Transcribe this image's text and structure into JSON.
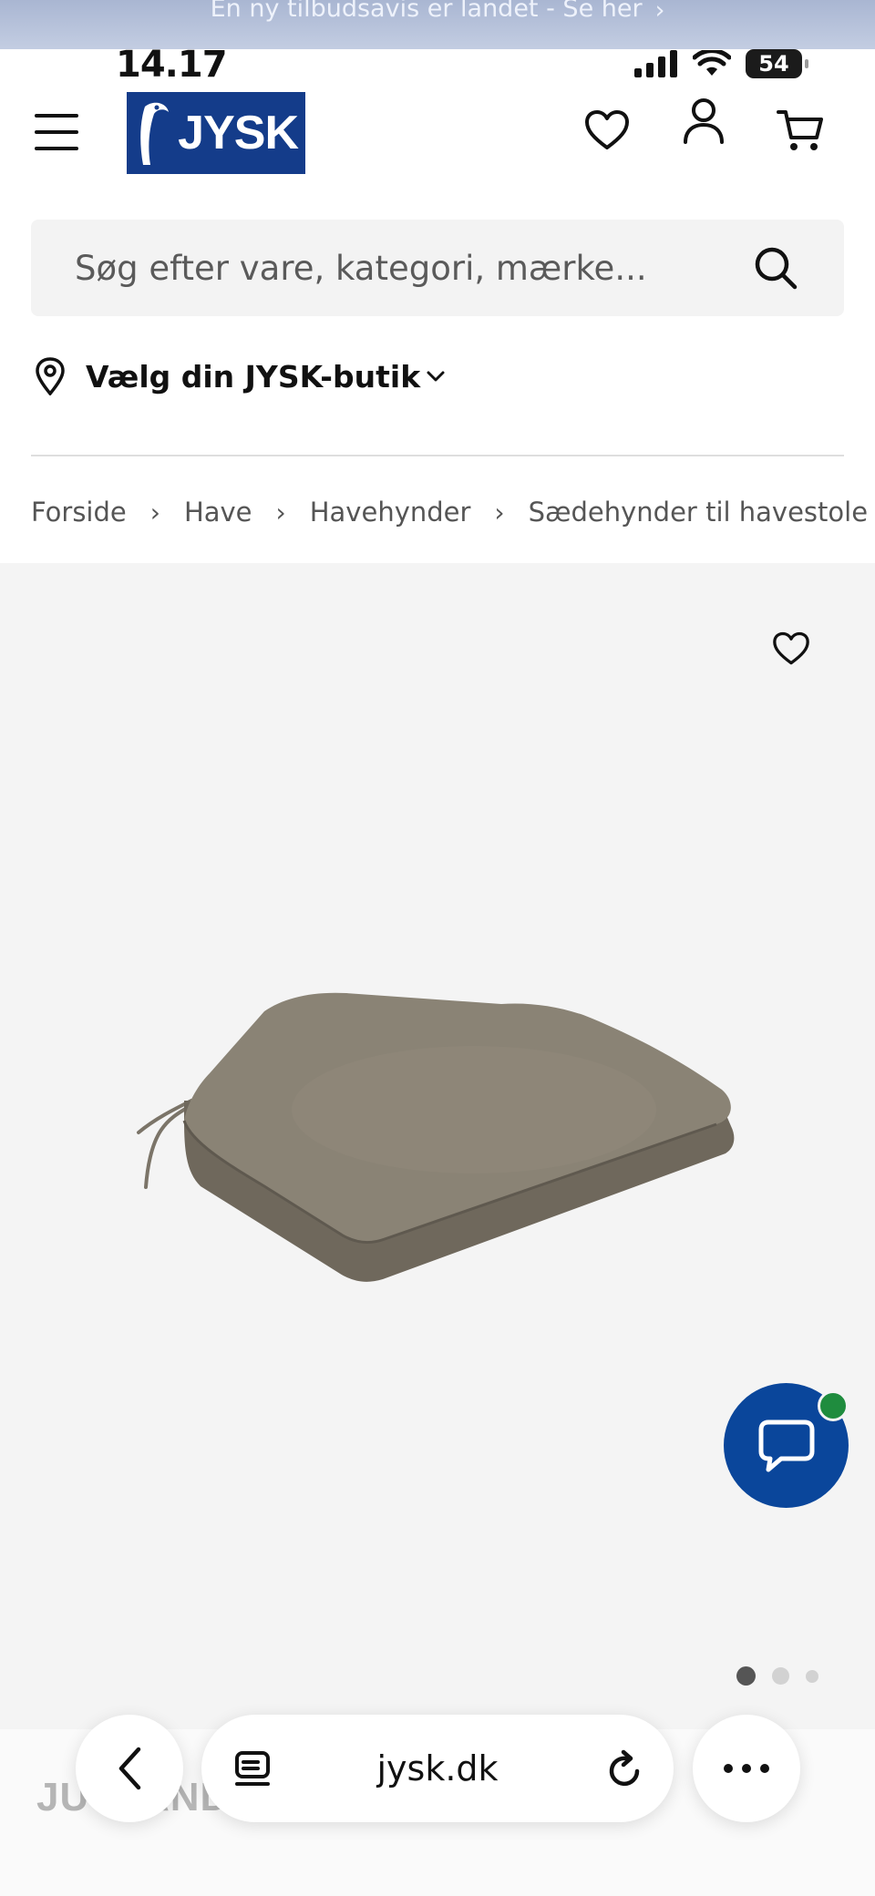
{
  "promo": {
    "text": "En ny tilbudsavis er landet - Se her",
    "chevron": "›"
  },
  "status": {
    "time": "14.17",
    "battery": "54"
  },
  "header": {
    "logo_text": "JYSK",
    "icons": [
      "menu-icon",
      "heart-icon",
      "user-icon",
      "cart-icon"
    ]
  },
  "search": {
    "placeholder": "Søg efter vare, kategori, mærke..."
  },
  "store": {
    "label": "Vælg din JYSK-butik"
  },
  "breadcrumb": {
    "items": [
      "Forside",
      "Have",
      "Havehynder",
      "Sædehynder til havestole"
    ],
    "separator": "›"
  },
  "gallery": {
    "image_count": 3,
    "active_index": 0
  },
  "footer": {
    "brand_ghost": "JUTLANDIA"
  },
  "browser": {
    "url": "jysk.dk"
  },
  "colors": {
    "brand_blue": "#143c8a",
    "chat_blue": "#0a469b",
    "online_green": "#1f8c3e"
  }
}
